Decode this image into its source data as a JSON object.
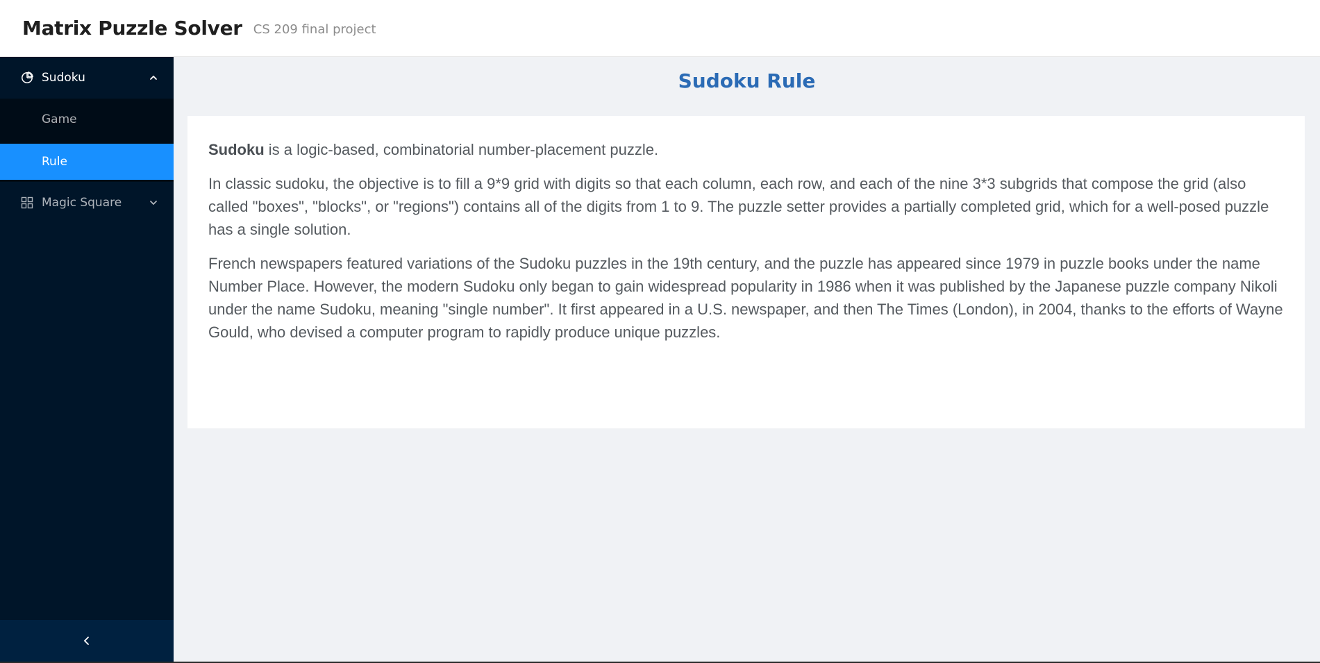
{
  "header": {
    "title": "Matrix Puzzle Solver",
    "subtitle": "CS 209 final project"
  },
  "sidebar": {
    "items": [
      {
        "label": "Sudoku",
        "icon": "pie-chart-icon",
        "expanded": true,
        "children": [
          {
            "label": "Game",
            "selected": false
          },
          {
            "label": "Rule",
            "selected": true
          }
        ]
      },
      {
        "label": "Magic Square",
        "icon": "appstore-icon",
        "expanded": false
      }
    ],
    "collapse_icon": "chevron-left-icon"
  },
  "main": {
    "title": "Sudoku Rule",
    "intro_term": "Sudoku",
    "intro_rest": " is a logic-based, combinatorial number-placement puzzle.",
    "paragraph2": "In classic sudoku, the objective is to fill a 9*9 grid with digits so that each column, each row, and each of the nine 3*3 subgrids that compose the grid (also called \"boxes\", \"blocks\", or \"regions\") contains all of the digits from 1 to 9. The puzzle setter provides a partially completed grid, which for a well-posed puzzle has a single solution.",
    "paragraph3": "French newspapers featured variations of the Sudoku puzzles in the 19th century, and the puzzle has appeared since 1979 in puzzle books under the name Number Place. However, the modern Sudoku only began to gain widespread popularity in 1986 when it was published by the Japanese puzzle company Nikoli under the name Sudoku, meaning \"single number\". It first appeared in a U.S. newspaper, and then The Times (London), in 2004, thanks to the efforts of Wayne Gould, who devised a computer program to rapidly produce unique puzzles."
  },
  "colors": {
    "sider": "#001529",
    "submenu": "#000c17",
    "selected": "#1890ff",
    "title_blue": "#2b6bb5",
    "content_bg": "#f0f2f5"
  }
}
